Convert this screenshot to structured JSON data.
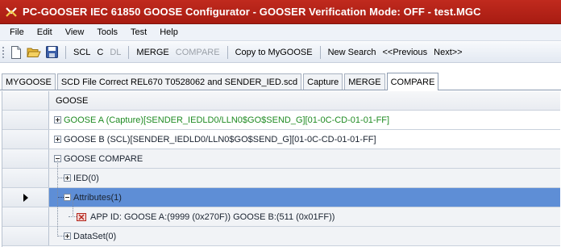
{
  "window": {
    "title": "PC-GOOSER   IEC 61850 GOOSE Configurator - GOOSER Verification Mode: OFF - test.MGC",
    "accent": "#b3231a"
  },
  "menu": {
    "items": [
      "File",
      "Edit",
      "View",
      "Tools",
      "Test",
      "Help"
    ]
  },
  "toolbar": {
    "scl": "SCL",
    "c": "C",
    "dl": "DL",
    "merge": "MERGE",
    "compare": "COMPARE",
    "copy": "Copy to MyGOOSE",
    "new_search": "New Search",
    "previous": "<<Previous",
    "next": "Next>>"
  },
  "tabs": [
    {
      "label": "MYGOOSE"
    },
    {
      "label": "SCD File Correct REL670 T0528062 and SENDER_IED.scd"
    },
    {
      "label": "Capture"
    },
    {
      "label": "MERGE"
    },
    {
      "label": "COMPARE"
    }
  ],
  "grid": {
    "column_header": "GOOSE",
    "rows": {
      "goose_a": "GOOSE A (Capture)[SENDER_IEDLD0/LLN0$GO$SEND_G][01-0C-CD-01-01-FF]",
      "goose_b": "GOOSE B (SCL)[SENDER_IEDLD0/LLN0$GO$SEND_G][01-0C-CD-01-01-FF]",
      "compare": "GOOSE COMPARE",
      "ied": "IED(0)",
      "attributes": "Attributes(1)",
      "app_id": "APP ID: GOOSE A:(9999 (0x270F))    GOOSE B:(511 (0x01FF))",
      "dataset": "DataSet(0)"
    }
  },
  "colors": {
    "selected_row": "#5e8ed6",
    "goose_a_text": "#1f8b22"
  }
}
